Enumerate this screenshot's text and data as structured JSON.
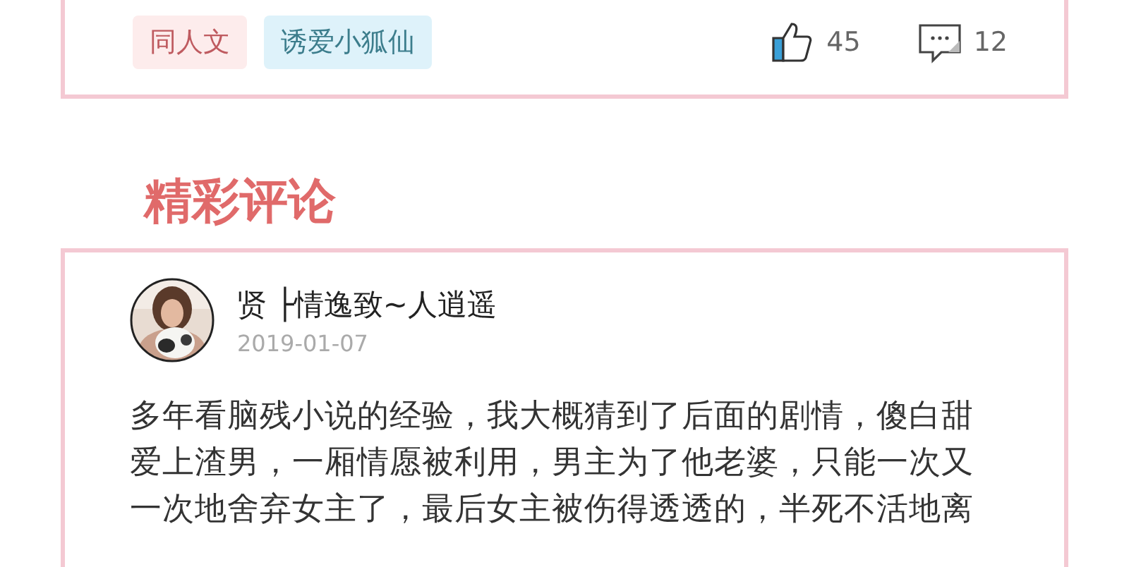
{
  "post_card": {
    "tags": [
      {
        "label": "同人文",
        "kind": "category"
      },
      {
        "label": "诱爱小狐仙",
        "kind": "author"
      }
    ],
    "likes": "45",
    "comments": "12"
  },
  "section_title": "精彩评论",
  "comment": {
    "username": "贤 ├情逸致~人逍遥",
    "date": "2019-01-07",
    "body": "多年看脑残小说的经验，我大概猜到了后面的剧情，傻白甜爱上渣男，一厢情愿被利用，男主为了他老婆，只能一次又一次地舍弃女主了，最后女主被伤得透透的，半死不活地离"
  }
}
